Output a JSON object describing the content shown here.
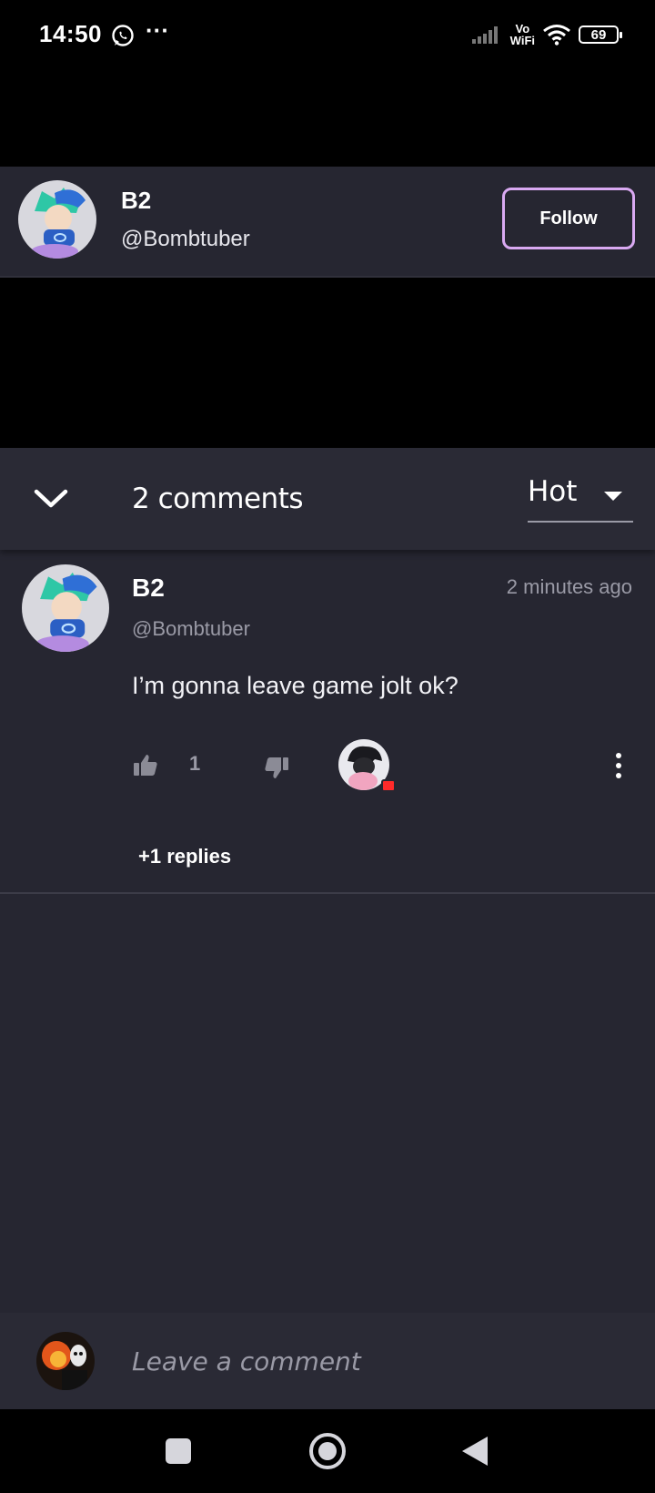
{
  "status_bar": {
    "time": "14:50",
    "notification_icons": [
      "whatsapp-icon"
    ],
    "overflow": "···",
    "vowifi_line1": "Vo",
    "vowifi_line2": "WiFi",
    "battery": "69"
  },
  "profile": {
    "name": "B2",
    "handle": "@Bombtuber",
    "follow_label": "Follow"
  },
  "comments_header": {
    "count_label": "2 comments",
    "sort_value": "Hot"
  },
  "comment": {
    "author": "B2",
    "handle": "@Bombtuber",
    "time": "2 minutes ago",
    "body": "I’m gonna leave game jolt ok?",
    "likes": "1",
    "replies_label": "+1 replies"
  },
  "comment_input": {
    "placeholder": "Leave a comment"
  },
  "colors": {
    "panel_bg": "#262631",
    "follow_border": "#d9a9f2",
    "muted_text": "#9a9aa6",
    "badge_red": "#ff2a2a"
  }
}
